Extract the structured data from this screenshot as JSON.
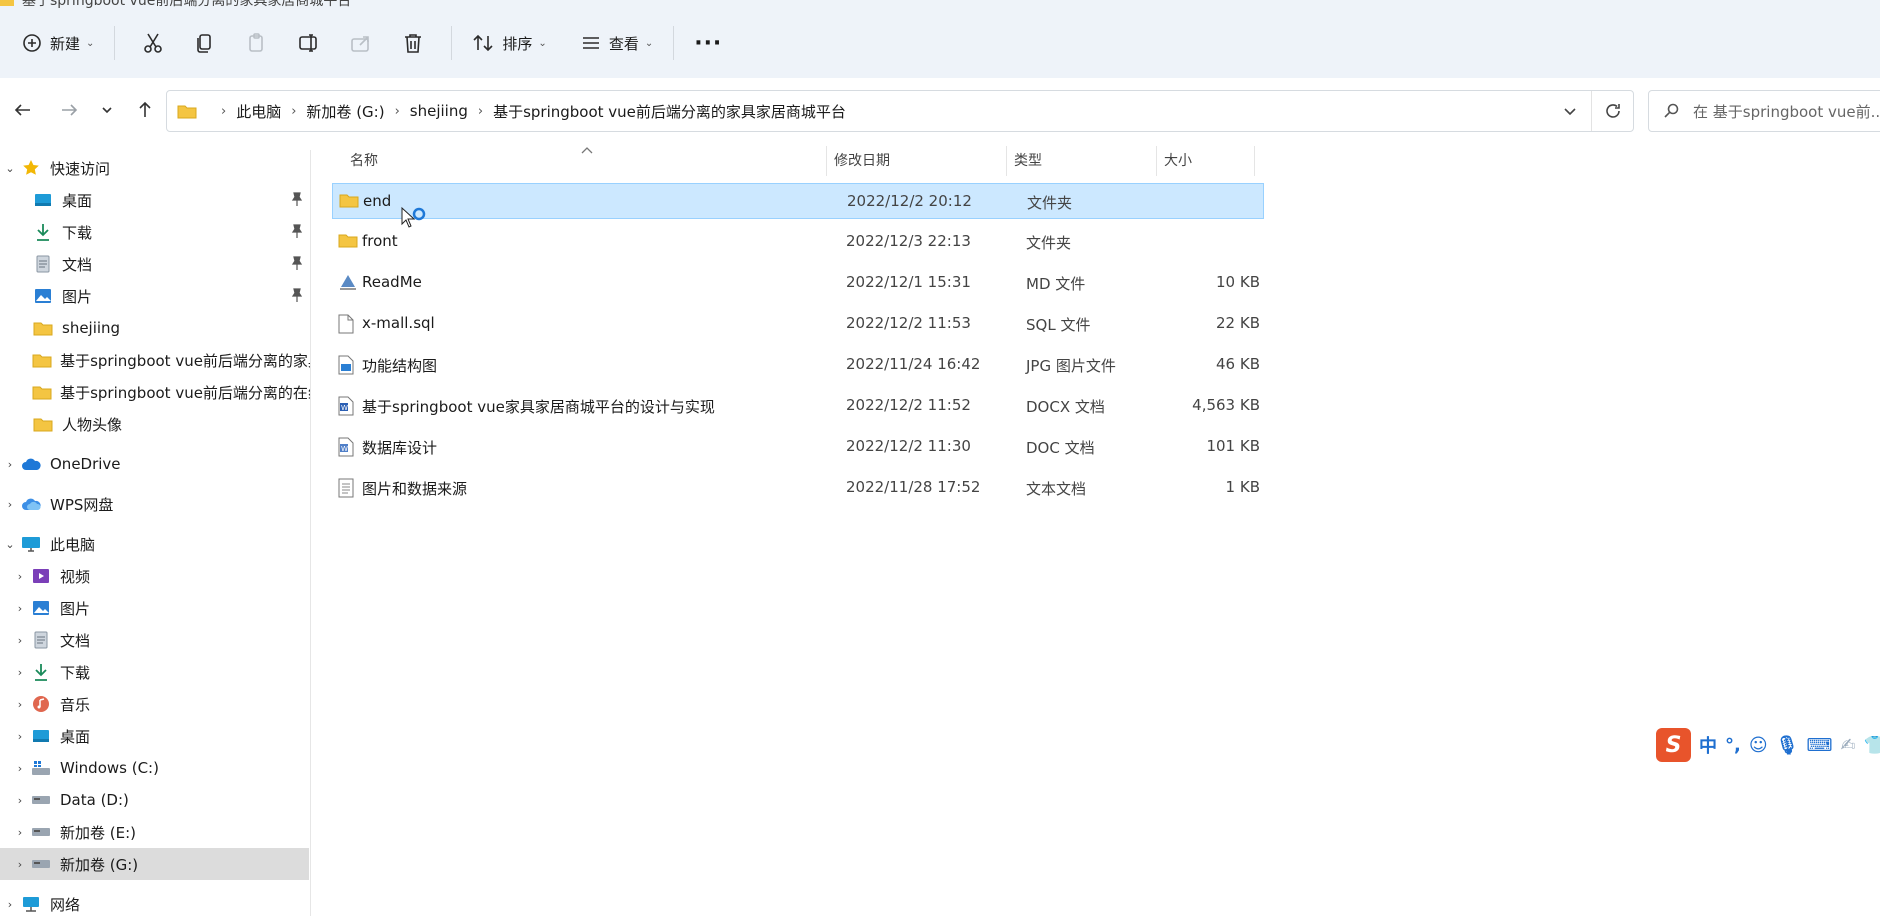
{
  "window": {
    "title": "基于springboot vue前后端分离的家具家居商城平台"
  },
  "toolbar": {
    "new_label": "新建",
    "sort_label": "排序",
    "view_label": "查看",
    "more_label": "···"
  },
  "address": {
    "crumbs": [
      "此电脑",
      "新加卷 (G:)",
      "shejiing",
      "基于springboot vue前后端分离的家具家居商城平台"
    ],
    "search_placeholder": "在 基于springboot vue前..."
  },
  "sidebar": {
    "quick_access": "快速访问",
    "quick_items": [
      "桌面",
      "下载",
      "文档",
      "图片",
      "shejiing",
      "基于springboot vue前后端分离的家具",
      "基于springboot vue前后端分离的在线",
      "人物头像"
    ],
    "onedrive": "OneDrive",
    "wps": "WPS网盘",
    "this_pc": "此电脑",
    "pc_items": [
      "视频",
      "图片",
      "文档",
      "下载",
      "音乐",
      "桌面",
      "Windows (C:)",
      "Data (D:)",
      "新加卷 (E:)",
      "新加卷 (G:)"
    ],
    "network": "网络"
  },
  "columns": {
    "name": "名称",
    "date": "修改日期",
    "type": "类型",
    "size": "大小"
  },
  "files": [
    {
      "name": "end",
      "date": "2022/12/2 20:12",
      "type": "文件夹",
      "size": "",
      "icon": "folder-icon"
    },
    {
      "name": "front",
      "date": "2022/12/3 22:13",
      "type": "文件夹",
      "size": "",
      "icon": "folder-icon"
    },
    {
      "name": "ReadMe",
      "date": "2022/12/1 15:31",
      "type": "MD 文件",
      "size": "10 KB",
      "icon": "md-file-icon"
    },
    {
      "name": "x-mall.sql",
      "date": "2022/12/2 11:53",
      "type": "SQL 文件",
      "size": "22 KB",
      "icon": "file-icon"
    },
    {
      "name": "功能结构图",
      "date": "2022/11/24 16:42",
      "type": "JPG 图片文件",
      "size": "46 KB",
      "icon": "image-file-icon"
    },
    {
      "name": "基于springboot vue家具家居商城平台的设计与实现",
      "date": "2022/12/2 11:52",
      "type": "DOCX 文档",
      "size": "4,563 KB",
      "icon": "docx-file-icon"
    },
    {
      "name": "数据库设计",
      "date": "2022/12/2 11:30",
      "type": "DOC 文档",
      "size": "101 KB",
      "icon": "doc-file-icon"
    },
    {
      "name": "图片和数据来源",
      "date": "2022/11/28 17:52",
      "type": "文本文档",
      "size": "1 KB",
      "icon": "text-file-icon"
    }
  ],
  "ime": {
    "mode": "中",
    "punct": "°,"
  }
}
